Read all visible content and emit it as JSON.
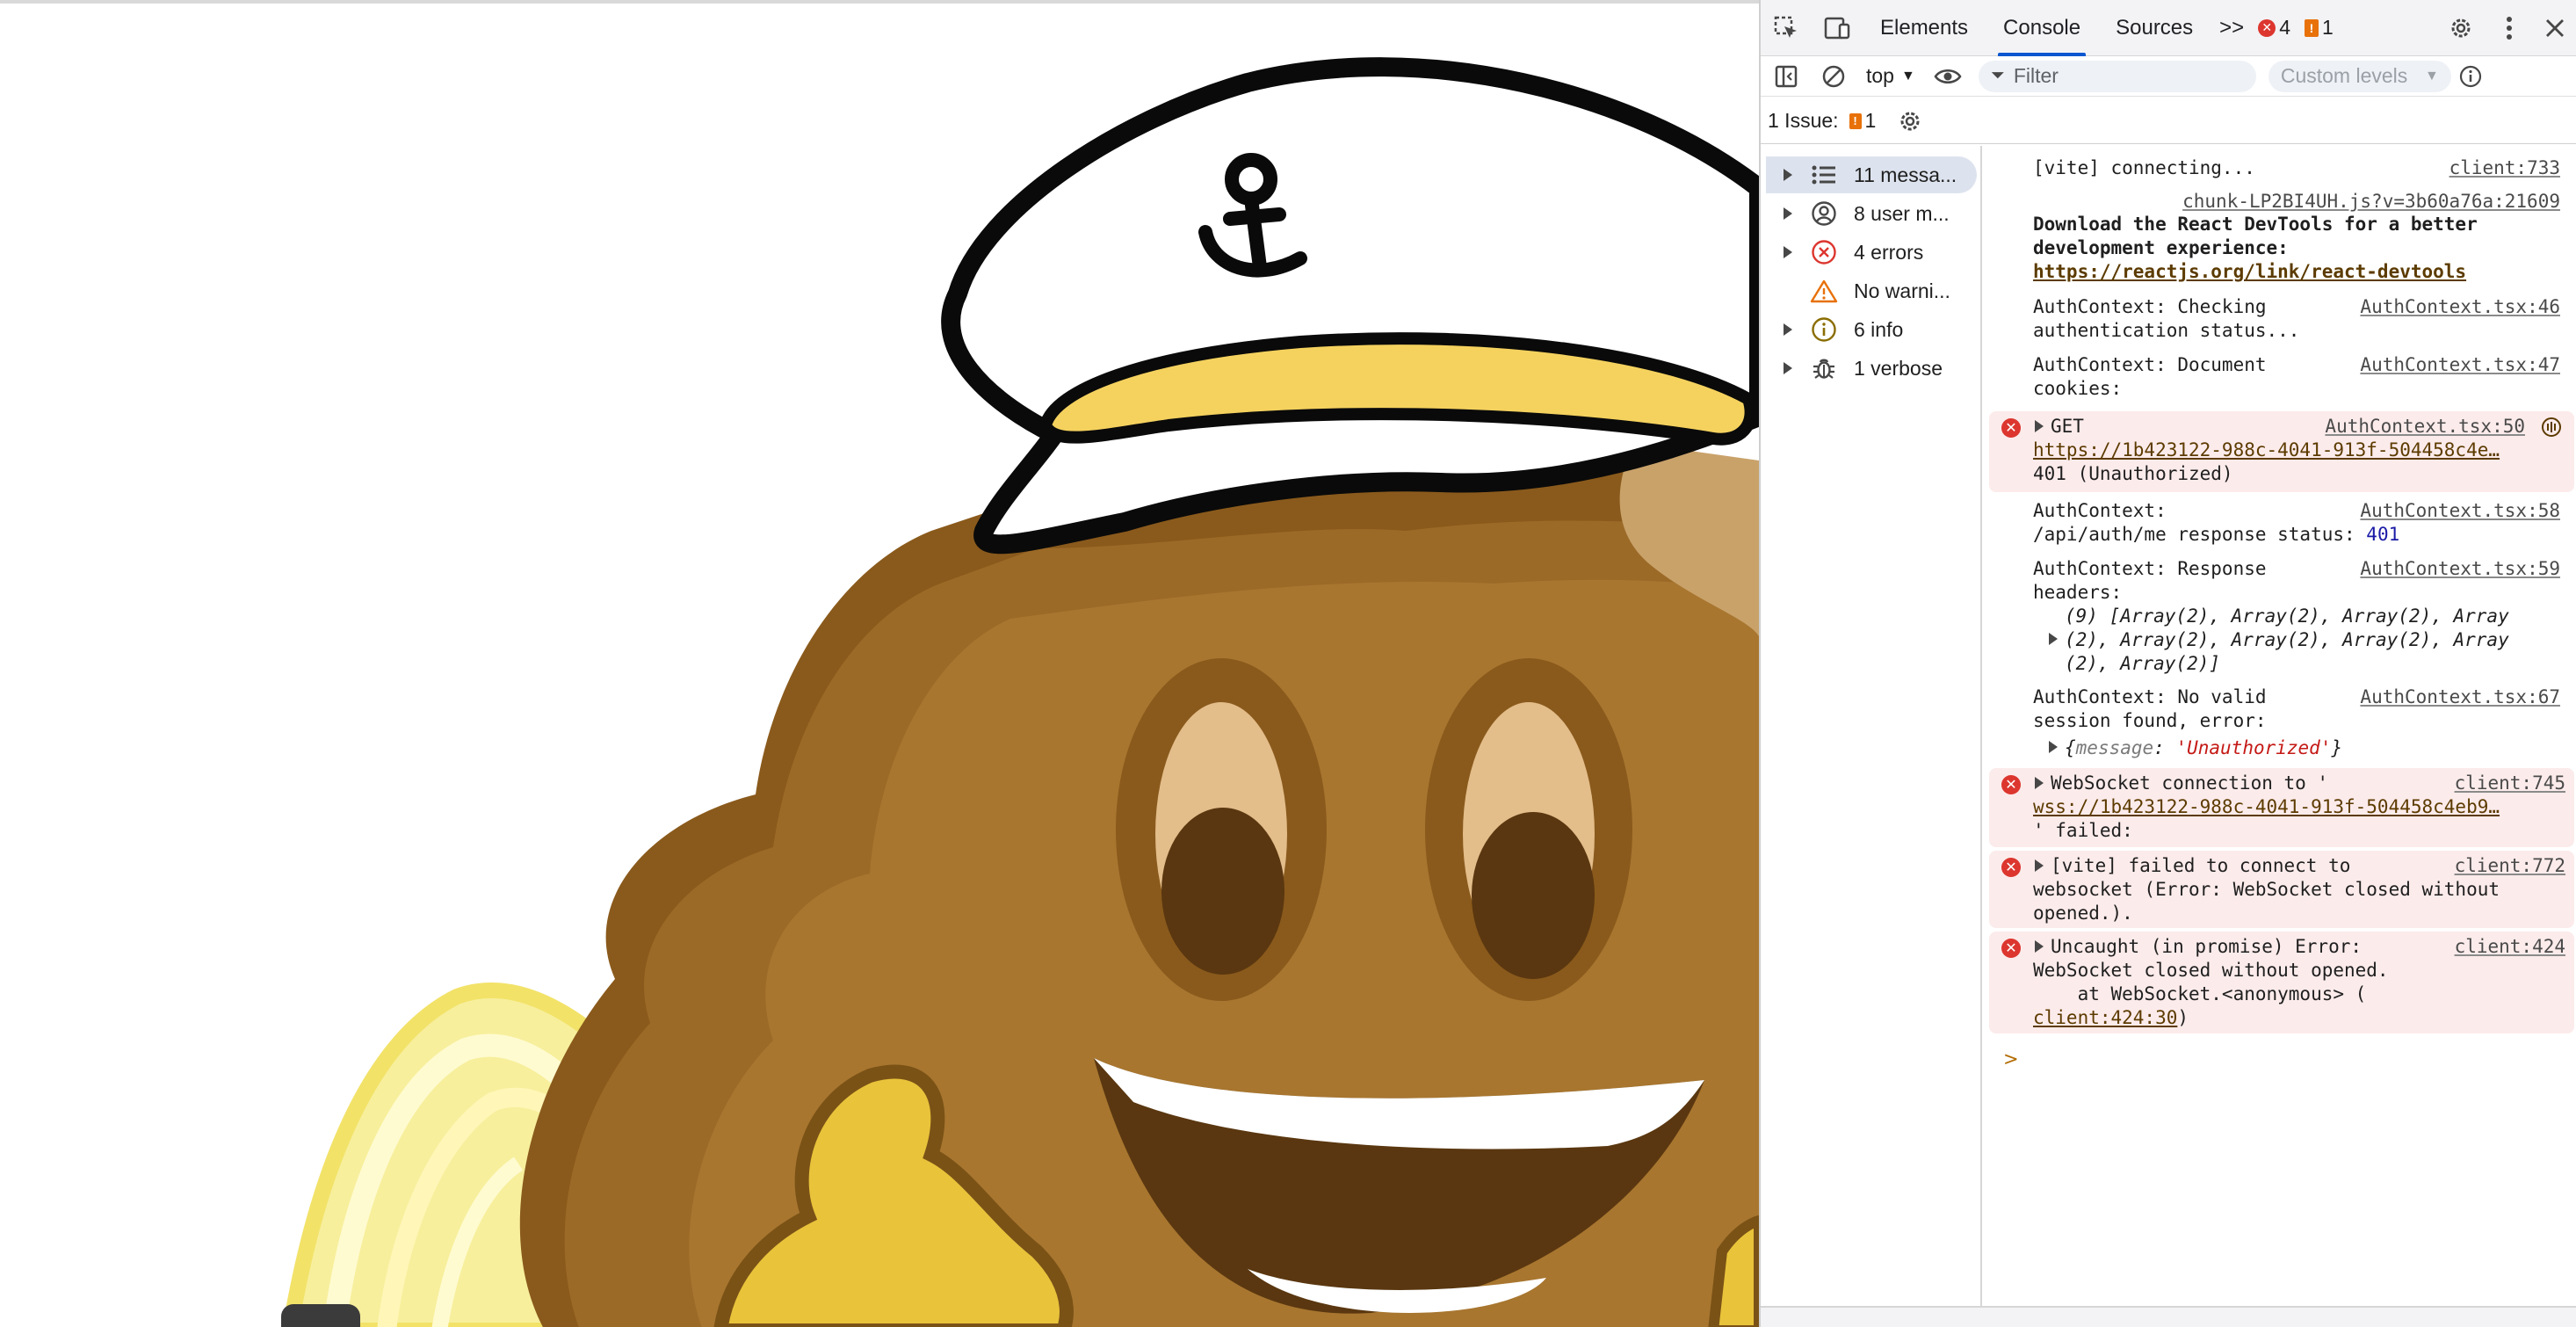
{
  "devtools": {
    "tabs": [
      "Elements",
      "Console",
      "Sources"
    ],
    "more_tabs": ">>",
    "error_count": "4",
    "warning_count": "1",
    "context": "top",
    "filter_placeholder": "Filter",
    "levels": "Custom levels",
    "issues_label": "1 Issue:",
    "issues_count": "1",
    "sidebar": [
      {
        "label": "11 messa...",
        "icon": "list-icon"
      },
      {
        "label": "8 user m...",
        "icon": "user-icon"
      },
      {
        "label": "4 errors",
        "icon": "error-icon"
      },
      {
        "label": "No warni...",
        "icon": "warning-icon"
      },
      {
        "label": "6 info",
        "icon": "info-icon"
      },
      {
        "label": "1 verbose",
        "icon": "bug-icon"
      }
    ],
    "messages": {
      "m1": {
        "text": "[vite] connecting...",
        "src": "client:733"
      },
      "m2": {
        "src": "chunk-LP2BI4UH.js?v=3b60a76a:21609",
        "l1": "Download the React DevTools for a better",
        "l2": "development experience:",
        "link": "https://reactjs.org/link/react-devtools"
      },
      "m3": {
        "l1": "AuthContext: Checking",
        "l2": "authentication status...",
        "src": "AuthContext.tsx:46"
      },
      "m4": {
        "l1": "AuthContext: Document",
        "l2": "cookies:",
        "src": "AuthContext.tsx:47"
      },
      "m5": {
        "l1": "GET",
        "link": "https://1b423122-988c-4041-913f-504458c4e…",
        "l3": "401 (Unauthorized)",
        "src": "AuthContext.tsx:50"
      },
      "m6": {
        "l1": "AuthContext:",
        "l2a": "/api/auth/me response status: ",
        "l2b": "401",
        "src": "AuthContext.tsx:58"
      },
      "m7": {
        "l1": "AuthContext: Response",
        "l2": "headers:",
        "l3": "(9) [Array(2), Array(2), Array(2), Array",
        "l4": "(2), Array(2), Array(2), Array(2), Array",
        "l5": "(2), Array(2)]",
        "src": "AuthContext.tsx:59"
      },
      "m8": {
        "l1": "AuthContext: No valid",
        "l2": "session found, error:",
        "l3a": "{",
        "l3b": "message",
        "l3c": ": ",
        "l3d": "'Unauthorized'",
        "l3e": "}",
        "src": "AuthContext.tsx:67"
      },
      "m9": {
        "l1": "WebSocket connection to '",
        "link": "wss://1b423122-988c-4041-913f-504458c4eb9…",
        "l3": "' failed:",
        "src": "client:745"
      },
      "m10": {
        "l1": "[vite] failed to connect to",
        "l2": "websocket (Error: WebSocket closed without",
        "l3": "opened.).",
        "src": "client:772"
      },
      "m11": {
        "l1": "Uncaught (in promise) Error:",
        "l2": "WebSocket closed without opened.",
        "l3": "    at WebSocket.<anonymous> (",
        "link": "client:424:30",
        "l4end": ")",
        "src": "client:424"
      }
    },
    "prompt": ">"
  }
}
